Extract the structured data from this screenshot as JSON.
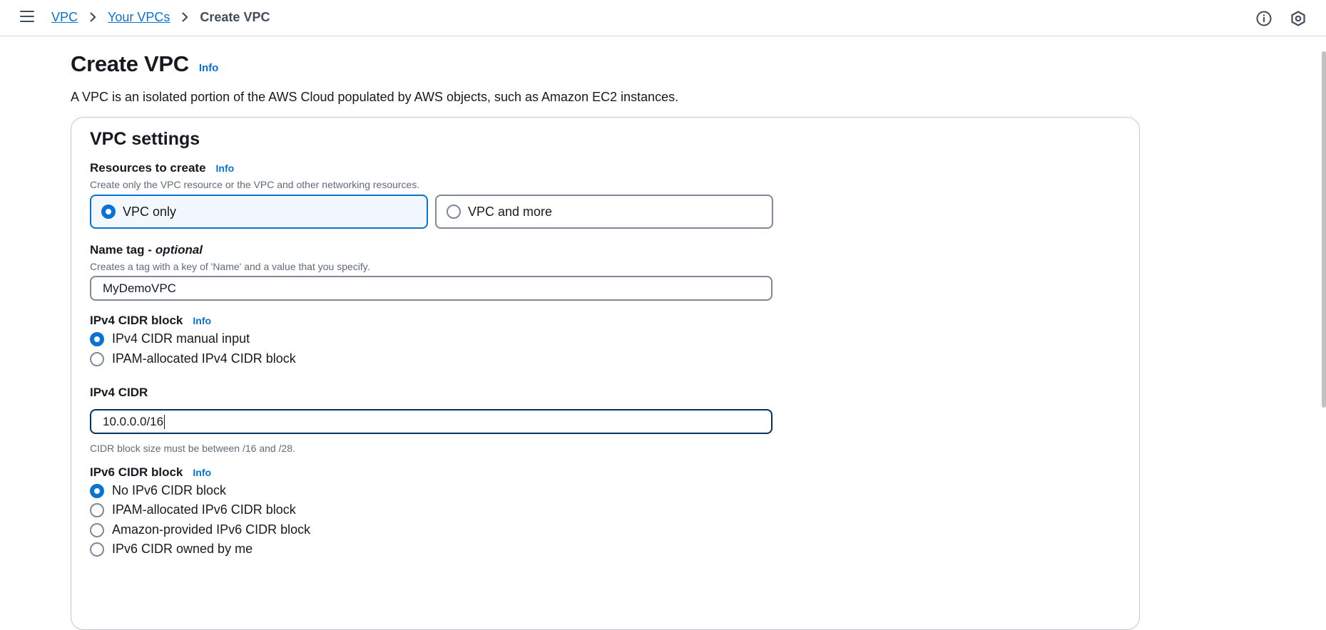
{
  "breadcrumb": {
    "items": [
      "VPC",
      "Your VPCs"
    ],
    "current": "Create VPC"
  },
  "header": {
    "title": "Create VPC",
    "info": "Info",
    "description": "A VPC is an isolated portion of the AWS Cloud populated by AWS objects, such as Amazon EC2 instances."
  },
  "panel": {
    "title": "VPC settings",
    "resources": {
      "label": "Resources to create",
      "info": "Info",
      "description": "Create only the VPC resource or the VPC and other networking resources.",
      "options": [
        "VPC only",
        "VPC and more"
      ],
      "selected": "VPC only"
    },
    "name_tag": {
      "label": "Name tag -",
      "optional": "optional",
      "description": "Creates a tag with a key of 'Name' and a value that you specify.",
      "value": "MyDemoVPC"
    },
    "ipv4_block": {
      "label": "IPv4 CIDR block",
      "info": "Info",
      "options": [
        "IPv4 CIDR manual input",
        "IPAM-allocated IPv4 CIDR block"
      ],
      "selected": "IPv4 CIDR manual input"
    },
    "ipv4_cidr": {
      "label": "IPv4 CIDR",
      "value": "10.0.0.0/16",
      "hint": "CIDR block size must be between /16 and /28."
    },
    "ipv6_block": {
      "label": "IPv6 CIDR block",
      "info": "Info",
      "options": [
        "No IPv6 CIDR block",
        "IPAM-allocated IPv6 CIDR block",
        "Amazon-provided IPv6 CIDR block",
        "IPv6 CIDR owned by me"
      ],
      "selected": "No IPv6 CIDR block"
    }
  },
  "colors": {
    "accent": "#0972d3",
    "text": "#16191f",
    "muted": "#5f6b7a",
    "border": "#7d8998"
  },
  "icons": [
    "hamburger-menu-icon",
    "chevron-right-icon",
    "info-circle-icon",
    "settings-hexagon-icon"
  ]
}
